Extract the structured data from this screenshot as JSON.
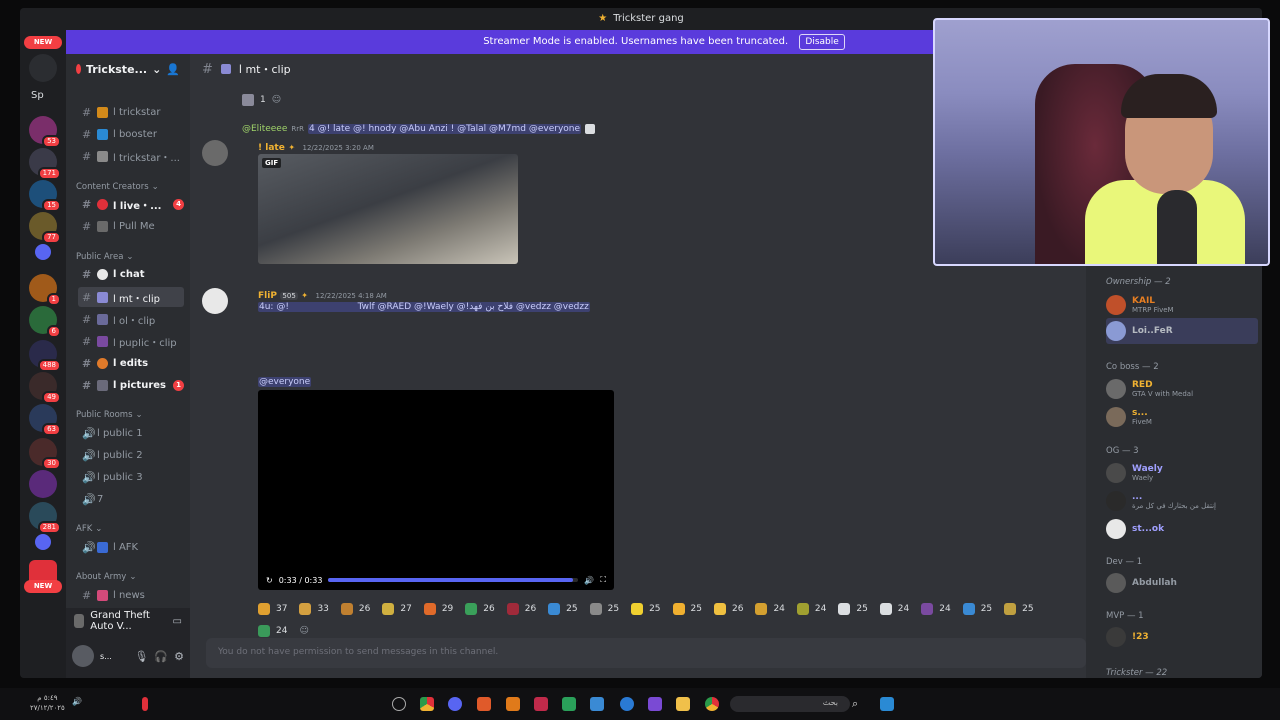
{
  "window": {
    "title": "Trickster gang"
  },
  "banner": {
    "text": "Streamer Mode is enabled. Usernames have been truncated.",
    "button": "Disable"
  },
  "rail": {
    "new_badge_top": "NEW",
    "sp_label": "Sp",
    "badges": [
      "53",
      "171",
      "15",
      "77",
      "1",
      "6",
      "488",
      "49",
      "63",
      "30",
      "281"
    ],
    "new_badge_bottom": "NEW"
  },
  "server": {
    "name": "Trickste..."
  },
  "channels": [
    {
      "label": "ا trickstar",
      "kind": "text"
    },
    {
      "label": "ا booster",
      "kind": "text"
    },
    {
      "label": "ا trickstar・...",
      "kind": "text"
    },
    {
      "label": "ا live・...",
      "kind": "text",
      "count": "4"
    },
    {
      "label": "ا Pull Me",
      "kind": "text"
    },
    {
      "label": "ا chat",
      "kind": "text"
    },
    {
      "label": "ا mt・clip",
      "kind": "text"
    },
    {
      "label": "ا ol・clip",
      "kind": "text"
    },
    {
      "label": "ا pupIic・clip",
      "kind": "text"
    },
    {
      "label": "ا edits",
      "kind": "text"
    },
    {
      "label": "ا pictures",
      "kind": "text",
      "count": "1"
    },
    {
      "label": "ا public 1",
      "kind": "voice"
    },
    {
      "label": "ا public 2",
      "kind": "voice"
    },
    {
      "label": "ا public 3",
      "kind": "voice"
    },
    {
      "label": "7",
      "kind": "voice"
    },
    {
      "label": "ا AFK",
      "kind": "voice"
    },
    {
      "label": "ا news",
      "kind": "text"
    }
  ],
  "categories": [
    "Content Creators",
    "Public Area",
    "Public Rooms",
    "AFK",
    "About Army"
  ],
  "voice_status": {
    "label": "Grand Theft Auto V..."
  },
  "user": {
    "name": "s..."
  },
  "chat": {
    "channel_title": "ا mt・clip",
    "top_reaction_count": "1",
    "msg1": {
      "reply_to": "@Eliteeee",
      "reply_tag": "RrR",
      "reply_content": "4 @! late @! hnody @Abu Anzi ! @Talal @M7md @everyone",
      "author": "! late",
      "timestamp": "12/22/2025 3:20 AM",
      "gif_label": "GIF"
    },
    "msg2": {
      "author": "FliP",
      "tag": "505",
      "timestamp": "12/22/2025 4:18 AM",
      "content": "4u: @!                        Twlf @RAED @!Waely @!فلاح بن فهد @vedzz @vedzz",
      "mention": "@everyone",
      "video_time": "0:33 / 0:33",
      "video_progress": 0.98
    },
    "reactions": [
      "37",
      "33",
      "26",
      "27",
      "29",
      "26",
      "26",
      "25",
      "25",
      "25",
      "25",
      "26",
      "24",
      "24",
      "25",
      "24",
      "24",
      "25",
      "25",
      "24"
    ],
    "composer_placeholder": "You do not have permission to send messages in this channel."
  },
  "members": {
    "categories": [
      "Ownership — 2",
      "Co boss — 2",
      "OG — 3",
      "Dev — 1",
      "MVP — 1",
      "Trickster — 22"
    ],
    "list": [
      {
        "name": "KAIL",
        "status": "MTRP FiveM",
        "color": "#e67e22"
      },
      {
        "name": "Loi..FeR",
        "status": "",
        "color": "#b5bac1"
      },
      {
        "name": "RED",
        "status": "GTA V with Medal",
        "color": "#f0b232"
      },
      {
        "name": "s...",
        "status": "FiveM",
        "color": "#f0b232"
      },
      {
        "name": "Waely",
        "status": "Waely",
        "color": "#a0a0ff"
      },
      {
        "name": "...",
        "status": "إنتقل من بحثارك في كل مرة",
        "color": "#a0a0ff"
      },
      {
        "name": "st...ok",
        "status": "",
        "color": "#a0a0ff"
      },
      {
        "name": "Abdullah",
        "status": "",
        "color": "#949ba4"
      },
      {
        "name": "!23",
        "status": "",
        "color": "#f0b232"
      }
    ]
  },
  "taskbar": {
    "clock_time": "٥:٤٩ م",
    "clock_date": "٢٧/١٢/٢٠٢٥",
    "search_label": "بحث"
  },
  "colors": {
    "accent": "#5865f2",
    "banner": "#5a3bdc",
    "danger": "#f23f43"
  }
}
